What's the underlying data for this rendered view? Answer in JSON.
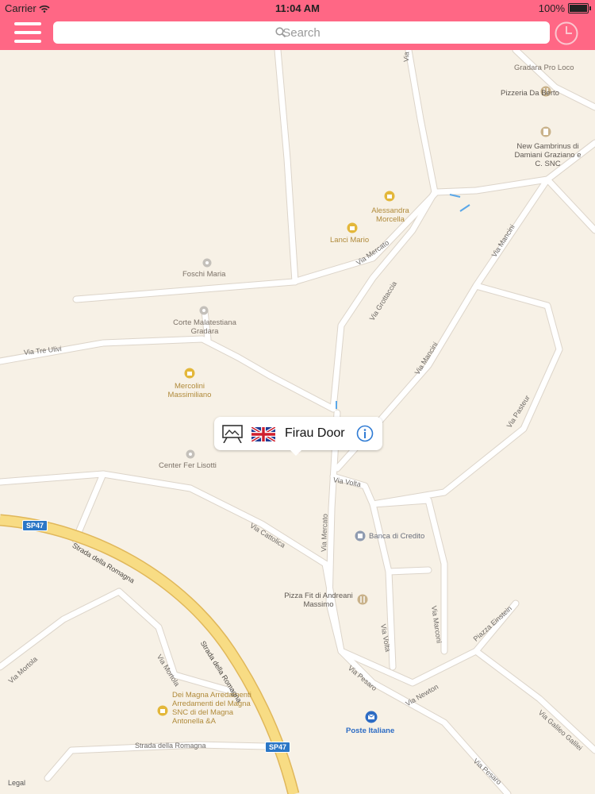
{
  "status": {
    "carrier": "Carrier",
    "time": "11:04 AM",
    "battery": "100%"
  },
  "search": {
    "placeholder": "Search"
  },
  "icons": {
    "menu": "hamburger-menu-icon",
    "history": "clock-icon",
    "pin": "pink-map-pin-icon",
    "info": "info-icon",
    "flag": "uk-flag-icon",
    "category": "easel-icon"
  },
  "colors": {
    "bar": "#ff6785",
    "map_bg": "#f7f1e6",
    "road": "#ffffff",
    "highway": "#f6d97a",
    "pin": "#e8477a",
    "info": "#2f7bd4"
  },
  "callout": {
    "title": "Firau Door"
  },
  "pois": [
    {
      "name": "Gradara Pro Loco"
    },
    {
      "name": "Pizzeria Da Berto"
    },
    {
      "name": "New Gambrinus di Damiani Graziano e C. SNC"
    },
    {
      "name": "Alessandra Morcella"
    },
    {
      "name": "Lanci Mario"
    },
    {
      "name": "Foschi Maria"
    },
    {
      "name": "Corte Malatestiana Gradara"
    },
    {
      "name": "Mercolini Massimiliano"
    },
    {
      "name": "Center Fer Lisotti"
    },
    {
      "name": "Banca di Credito"
    },
    {
      "name": "Pizza Fit di Andreani Massimo"
    },
    {
      "name": "Dei Magna Arredamenti Arredamenti del Magna SNC di del Magna Antonella &A"
    },
    {
      "name": "Poste Italiane"
    }
  ],
  "streets": [
    "Via Tre Ulivi",
    "Via Mercato",
    "Via Grottaccia",
    "Via Mancini",
    "Via Mancini",
    "Via Pasteur",
    "Via Volta",
    "Via Cattolica",
    "Via Mercato",
    "Strada della Romagna",
    "Strada della Romagna",
    "Via Volta",
    "Via Marconi",
    "Via Mortola",
    "Via Mortola",
    "Strada della Romagna",
    "Via Pesaro",
    "Via Newton",
    "Piazza Einstein",
    "Via Galileo Galilei",
    "Via Pesaro",
    "Via"
  ],
  "route_shields": [
    "SP47",
    "SP47"
  ],
  "legal": "Legal"
}
